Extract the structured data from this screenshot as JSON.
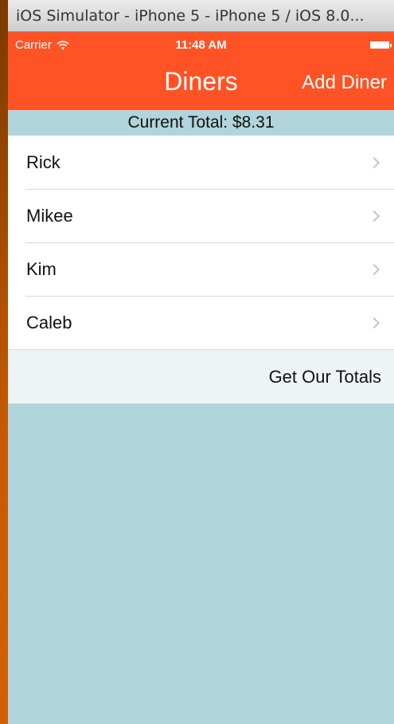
{
  "window": {
    "title": "iOS Simulator - iPhone 5 - iPhone 5 / iOS 8.0..."
  },
  "status_bar": {
    "carrier": "Carrier",
    "time": "11:48 AM"
  },
  "nav": {
    "title": "Diners",
    "action_label": "Add Diner",
    "color": "#ff5326"
  },
  "summary": {
    "total_text": "Current Total: $8.31"
  },
  "diners": [
    {
      "name": "Rick"
    },
    {
      "name": "Mikee"
    },
    {
      "name": "Kim"
    },
    {
      "name": "Caleb"
    }
  ],
  "footer": {
    "button_label": "Get Our Totals"
  },
  "colors": {
    "background": "#b2d4dc",
    "footer": "#eef4f5"
  }
}
